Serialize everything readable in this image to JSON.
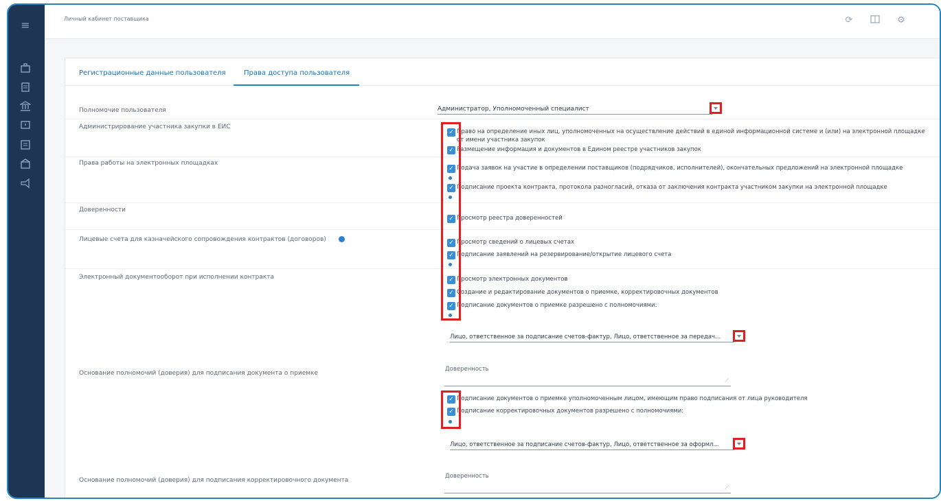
{
  "app": {
    "title": "Личный кабинет поставщика"
  },
  "sidebar": {
    "icons": [
      "menu-icon",
      "briefcase-icon",
      "document-icon",
      "bank-icon",
      "message-icon",
      "list-icon",
      "mail-icon",
      "megaphone-icon"
    ]
  },
  "topbar": {
    "icons": [
      "refresh-icon",
      "book-icon",
      "settings-icon"
    ]
  },
  "tabs": [
    {
      "label": "Регистрационные данные пользователя"
    },
    {
      "label": "Права доступа пользователя"
    }
  ],
  "authority": {
    "label": "Полномочие пользователя",
    "value": "Администратор, Уполномоченный специалист"
  },
  "sections": [
    {
      "label": "Администрирование участника закупки в ЕИС",
      "items": [
        "Право на определение иных лиц, уполномоченных на осуществление действий в единой информационной системе и (или) на электронной площадке",
        "от имени участника закупок",
        "Размещение информация и документов в Едином реестре участников закупок"
      ]
    },
    {
      "label": "Права работы на электронных площадках",
      "items": [
        "Подача заявок на участие в определении поставщиков (подрядчиков, исполнителей), окончательных предложений на электронной площадке",
        "Подписание проекта контракта, протокола разногласий, отказа от заключения контракта участником закупки на электронной площадке"
      ]
    },
    {
      "label": "Доверенности",
      "items": [
        "Просмотр реестра доверенностей"
      ]
    },
    {
      "label": "Лицевые счета для казначейского сопровождения контрактов (договоров)",
      "items": [
        "Просмотр сведений о лицевых счетах",
        "Подписание заявлений на резервирование/открытие лицевого счета"
      ]
    },
    {
      "label": "Электронный документооборот при исполнении контракта",
      "items": [
        "Просмотр электронных документов",
        "Создание и редактирование документов о приемке, корректировочных документов",
        "Подписание документов о приемке разрешено с полномочиями:"
      ]
    }
  ],
  "signer_select_1": {
    "value": "Лицо, ответственное за подписание счетов-фактур, Лицо, ответственное за передач..."
  },
  "basis_acceptance": {
    "label": "Основание полномочий (доверия) для подписания документа о приемке",
    "placeholder": "Доверенность"
  },
  "extra_items": [
    "Подписание документов о приемке уполномоченным лицом, имеющим право подписания от лица руководителя",
    "Подписание корректировочных документов разрешено с полномочиями:"
  ],
  "signer_select_2": {
    "value": "Лицо, ответственное за подписание счетов-фактур, Лицо, ответственное за оформл..."
  },
  "basis_correction": {
    "label": "Основание полномочий (доверия) для подписания корректировочного документа",
    "placeholder": "Доверенность"
  }
}
